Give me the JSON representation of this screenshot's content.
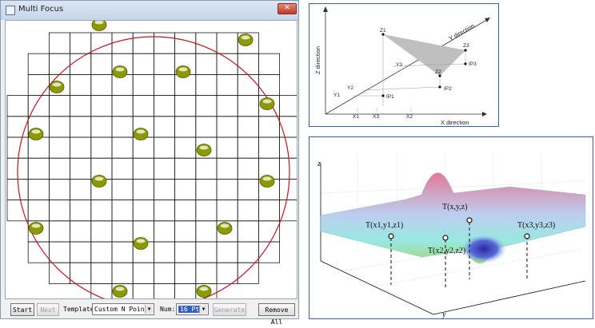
{
  "window": {
    "title": "Multi Focus",
    "close_glyph": "✕"
  },
  "toolbar": {
    "start_label": "Start",
    "next_label": "Next",
    "template_label": "Template:",
    "template_value": "Custom N Point",
    "num_label": "Num:",
    "num_value": "16 Pts",
    "generate_label": "Generate",
    "remove_all_label": "Remove All"
  },
  "colors": {
    "circle": "#c0161e",
    "grid": "#1a1a1a",
    "point": "#8c9a00",
    "selection": "#3060c0"
  },
  "diagram_top": {
    "labels": {
      "z_direction": "Z direction",
      "y_direction": "Y direction",
      "x_direction": "X direction",
      "z1": "Z1",
      "z2": "Z2",
      "z3": "Z3",
      "y1": "Y1",
      "y2": "Y2",
      "y3": "Y3",
      "ip1": "IP1",
      "ip2": "IP2",
      "ip3": "IP3",
      "x1": "X1",
      "x2": "X2",
      "x3": "X3"
    }
  },
  "diagram_bottom": {
    "labels": {
      "z_axis": "z",
      "y_axis": "y",
      "t_xyz": "T(x,y,z)",
      "t1": "T(x1,y1,z1)",
      "t2": "T(x2,y2,z2)",
      "t3": "T(x3,y3,z3)"
    }
  }
}
